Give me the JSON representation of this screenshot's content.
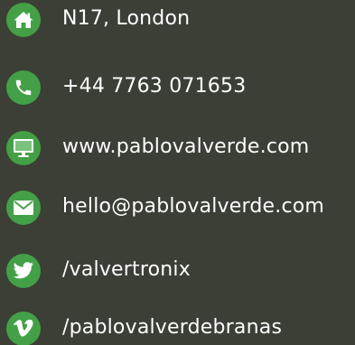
{
  "contacts": {
    "address": {
      "text": "N17, London",
      "icon": "home-icon"
    },
    "phone": {
      "text": "+44 7763 071653",
      "icon": "phone-icon"
    },
    "website": {
      "text": "www.pablovalverde.com",
      "icon": "monitor-icon"
    },
    "email": {
      "text": "hello@pablovalverde.com",
      "icon": "envelope-icon"
    },
    "twitter": {
      "text": "/valvertronix",
      "icon": "twitter-bird-icon"
    },
    "vimeo": {
      "text": "/pablovalverdebranas",
      "icon": "vimeo-icon"
    }
  },
  "colors": {
    "background": "#3c3f35",
    "icon_circle": "#43a047",
    "text": "#ffffff"
  }
}
